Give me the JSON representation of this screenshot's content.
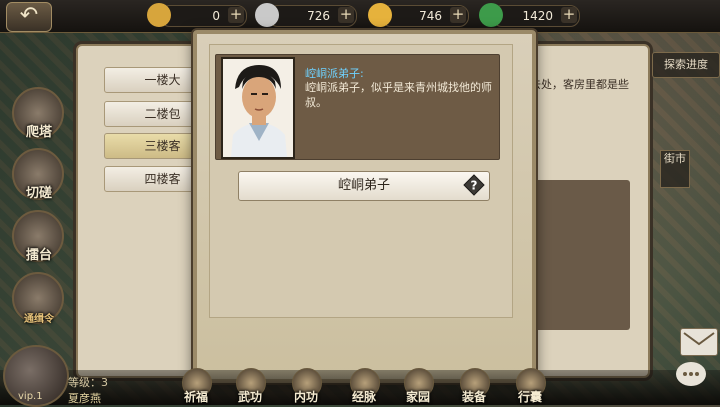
{
  "topbar": {
    "resources": [
      {
        "icon": "gold-ingot-icon",
        "value": "0",
        "color": "#d7a53c"
      },
      {
        "icon": "silver-ingot-icon",
        "value": "726",
        "color": "#c9c9c9"
      },
      {
        "icon": "coin-icon",
        "value": "746",
        "color": "#e6b23c"
      },
      {
        "icon": "jade-icon",
        "value": "1420",
        "color": "#3d9b4a"
      }
    ],
    "plus": "+",
    "back_glyph": "↶"
  },
  "left_menu": [
    {
      "icon": "tower-icon",
      "label": "爬塔"
    },
    {
      "icon": "sparring-icon",
      "label": "切磋"
    },
    {
      "icon": "arena-icon",
      "label": "擂台"
    },
    {
      "icon": "bounty-icon",
      "label": "通缉令"
    }
  ],
  "floors": [
    {
      "label": "一楼大",
      "selected": false
    },
    {
      "label": "二楼包",
      "selected": false
    },
    {
      "label": "三楼客",
      "selected": true
    },
    {
      "label": "四楼客",
      "selected": false
    }
  ],
  "under_panel": {
    "desc_fragment": "去处，客房里都是些",
    "explore_label": "探索进度",
    "city_label": "街市"
  },
  "modal": {
    "speaker": "崆峒派弟子:",
    "speech": "崆峒派弟子，似乎是来青州城找他的师叔。",
    "choice_label": "崆峒弟子",
    "accent": "#6fd2ff"
  },
  "bottom_bar": {
    "items": [
      {
        "icon": "pray-icon",
        "label": "祈福"
      },
      {
        "icon": "martial-arts-icon",
        "label": "武功"
      },
      {
        "icon": "inner-skill-icon",
        "label": "内功"
      },
      {
        "icon": "meridian-icon",
        "label": "经脉"
      },
      {
        "icon": "home-icon",
        "label": "家园"
      },
      {
        "icon": "equipment-icon",
        "label": "装备"
      },
      {
        "icon": "bag-icon",
        "label": "行囊"
      }
    ]
  },
  "player": {
    "level_text": "等级：3",
    "name": "夏彦燕",
    "vip": "vip.1"
  }
}
